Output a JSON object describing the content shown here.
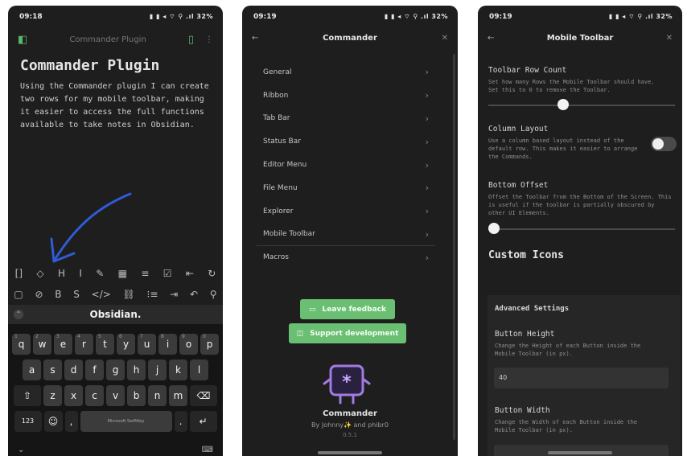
{
  "phone1": {
    "status": {
      "time": "09:18",
      "right": "32%"
    },
    "header": {
      "title": "Commander Plugin"
    },
    "heading": "Commander Plugin",
    "body": "Using the Commander plugin I can create two rows for my mobile toolbar, making it easier to access the full functions available to take notes in Obsidian.",
    "toolbar_row1": [
      "[]",
      "◇",
      "H",
      "I",
      "✎",
      "▦",
      "≡",
      "☑",
      "⇤",
      "↻"
    ],
    "toolbar_row2": [
      "▢",
      "⊘",
      "B",
      "S",
      "</>",
      "⛓",
      "⁝≡",
      "⇥",
      "↶",
      "⚲"
    ],
    "suggestion": "Obsidian.",
    "keys_row1": [
      "q",
      "w",
      "e",
      "r",
      "t",
      "y",
      "u",
      "i",
      "o",
      "p"
    ],
    "keys_row1_sup": [
      "1",
      "2",
      "3",
      "4",
      "5",
      "6",
      "7",
      "8",
      "9",
      "0"
    ],
    "keys_row2": [
      "a",
      "s",
      "d",
      "f",
      "g",
      "h",
      "j",
      "k",
      "l"
    ],
    "keys_row3": [
      "z",
      "x",
      "c",
      "v",
      "b",
      "n",
      "m"
    ],
    "key_123": "123",
    "space_label": "Microsoft SwiftKey"
  },
  "phone2": {
    "status": {
      "time": "09:19",
      "right": "32%"
    },
    "title": "Commander",
    "menu": [
      "General",
      "Ribbon",
      "Tab Bar",
      "Status Bar",
      "Editor Menu",
      "File Menu",
      "Explorer",
      "Mobile Toolbar",
      "Macros"
    ],
    "leave_feedback": "Leave feedback",
    "support": "Support development",
    "app_name": "Commander",
    "credits": "By Johnny✨ and phibr0",
    "version": "0.5.1"
  },
  "phone3": {
    "status": {
      "time": "09:19",
      "right": "32%"
    },
    "title": "Mobile Toolbar",
    "row_count": {
      "title": "Toolbar Row Count",
      "desc": "Set how many Rows the Mobile Toolbar should have. Set this to 0 to remove the Toolbar."
    },
    "column_layout": {
      "title": "Column Layout",
      "desc": "Use a column based layout instead of the default row. This makes it easier to arrange the Commands."
    },
    "bottom_offset": {
      "title": "Bottom Offset",
      "desc": "Offset the Toolbar from the Bottom of the Screen. This is useful if the toolbar is partially obscured by other UI Elements."
    },
    "custom_icons": "Custom Icons",
    "advanced": "Advanced Settings",
    "button_height": {
      "title": "Button Height",
      "desc": "Change the Height of each Button inside the Mobile Toolbar (in px).",
      "value": "40"
    },
    "button_width": {
      "title": "Button Width",
      "desc": "Change the Width of each Button inside the Mobile Toolbar (in px)."
    },
    "row_count_level": 0.37,
    "bottom_offset_level": 0.0,
    "column_layout_on": false
  },
  "colors": {
    "accent_green": "#6abf72",
    "bg": "#1e1e1e",
    "arrow_blue": "#2f5bd6"
  }
}
